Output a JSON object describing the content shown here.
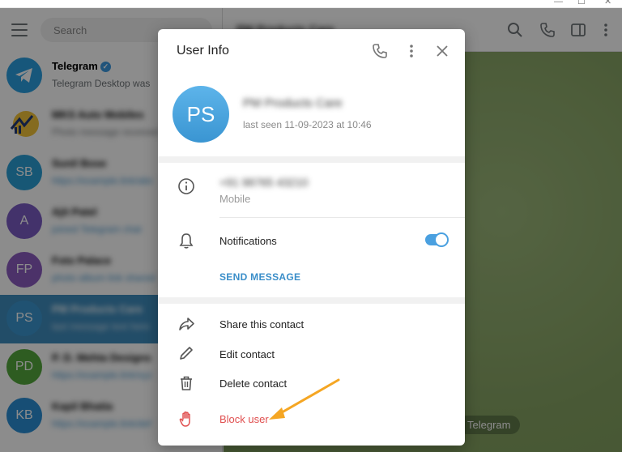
{
  "window": {
    "controls": [
      "—",
      "☐",
      "✕"
    ]
  },
  "sidebar": {
    "search_placeholder": "Search",
    "chats": [
      {
        "title": "Telegram",
        "subtitle": "Telegram Desktop was",
        "avatar_color": "#2a9ee0",
        "active": false
      },
      {
        "title": "MKS Auto Mobiles",
        "subtitle": "Photo message received",
        "avatar_color": "#f3c43a",
        "active": false
      },
      {
        "title": "Sunil Bose",
        "subtitle": "https://example.link/abc",
        "initials": "SB",
        "avatar_color": "#2a9ed6",
        "active": false
      },
      {
        "title": "Ajit Patel",
        "subtitle": "joined Telegram chat",
        "initials": "A",
        "avatar_color": "#7a5bc3",
        "active": false
      },
      {
        "title": "Foto Palace",
        "subtitle": "photo album link shared",
        "initials": "FP",
        "avatar_color": "#8b5bbf",
        "active": false
      },
      {
        "title": "PM Products Care",
        "subtitle": "last message text here",
        "initials": "PS",
        "avatar_color": "#3b96cf",
        "active": true
      },
      {
        "title": "P. D. Mehta Designs",
        "subtitle": "https://example.link/xyz",
        "initials": "PD",
        "avatar_color": "#55a83c",
        "active": false
      },
      {
        "title": "Kapil Bhatia",
        "subtitle": "https://example.link/def",
        "initials": "KB",
        "avatar_color": "#2a8ed6",
        "active": false
      }
    ]
  },
  "main": {
    "header_title": "PM Products Care",
    "service_pill": "Telegram"
  },
  "dialog": {
    "title": "User Info",
    "avatar_initials": "PS",
    "name": "PM Products Care",
    "last_seen": "last seen 11-09-2023 at 10:46",
    "phone_value": "+91 98765 43210",
    "phone_label": "Mobile",
    "notifications_label": "Notifications",
    "notifications_on": true,
    "send_message": "SEND MESSAGE",
    "actions": {
      "share": "Share this contact",
      "edit": "Edit contact",
      "delete": "Delete contact",
      "block": "Block user"
    }
  },
  "colors": {
    "accent": "#3a8ec9",
    "danger": "#e05050",
    "arrow": "#f5a623"
  }
}
